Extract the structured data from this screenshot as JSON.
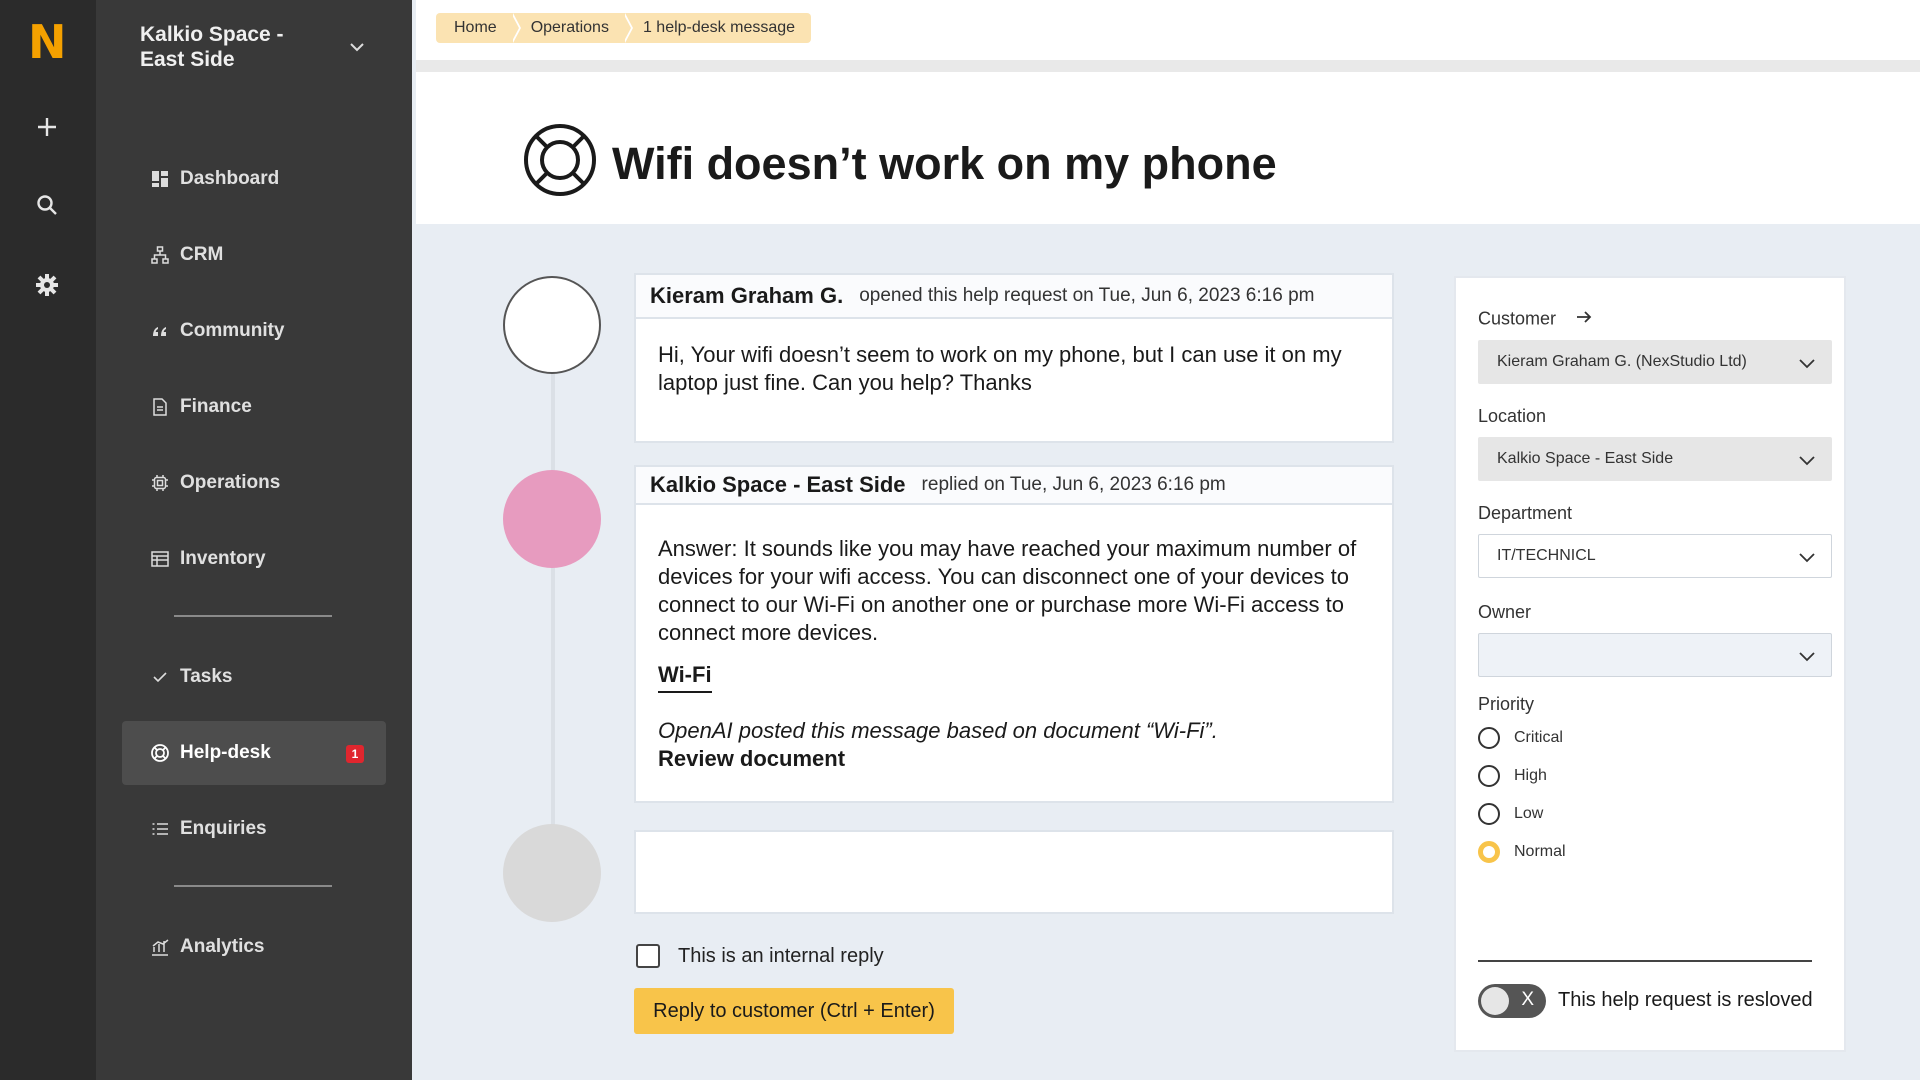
{
  "rail": {
    "logo": "N"
  },
  "sidebar": {
    "space_name": "Kalkio Space - East Side",
    "items": [
      {
        "label": "Dashboard"
      },
      {
        "label": "CRM"
      },
      {
        "label": "Community"
      },
      {
        "label": "Finance"
      },
      {
        "label": "Operations"
      },
      {
        "label": "Inventory"
      },
      {
        "label": "Tasks"
      },
      {
        "label": "Help-desk",
        "badge": "1"
      },
      {
        "label": "Enquiries"
      },
      {
        "label": "Analytics"
      }
    ]
  },
  "breadcrumbs": [
    "Home",
    "Operations",
    "1 help-desk message"
  ],
  "page": {
    "title": "Wifi doesn’t work on my phone"
  },
  "thread": {
    "messages": [
      {
        "author": "Kieram Graham G.",
        "meta": "opened this help request on Tue, Jun 6, 2023 6:16 pm",
        "body": "Hi, Your wifi doesn’t seem to work on my phone, but I can use it on my laptop just fine. Can you help? Thanks"
      },
      {
        "author": "Kalkio Space - East Side",
        "meta": "replied on Tue, Jun 6, 2023 6:16 pm",
        "body": "Answer: It sounds like you may have reached your maximum number of devices for your wifi access. You can disconnect one of your devices to connect to our Wi-Fi on another one or purchase more Wi-Fi access to connect more devices.",
        "doc_link": "Wi-Fi",
        "ai_note": "OpenAI posted this message based on document “Wi-Fi”.",
        "review_label": "Review document"
      }
    ],
    "internal_reply_label": "This is an internal reply",
    "reply_button": "Reply to customer (Ctrl + Enter)"
  },
  "panel": {
    "customer_label": "Customer",
    "customer_value": "Kieram Graham G. (NexStudio Ltd)",
    "location_label": "Location",
    "location_value": "Kalkio Space - East Side",
    "department_label": "Department",
    "department_value": "IT/TECHNICL",
    "owner_label": "Owner",
    "owner_value": "",
    "priority_label": "Priority",
    "priorities": [
      "Critical",
      "High",
      "Low",
      "Normal"
    ],
    "selected_priority": "Normal",
    "resolved_label": "This help request is resloved",
    "toggle_off_glyph": "X"
  },
  "colors": {
    "accent": "#f8c44a",
    "logo": "#f5a100",
    "badge": "#e0262e",
    "agent_avatar": "#e79bbf"
  }
}
